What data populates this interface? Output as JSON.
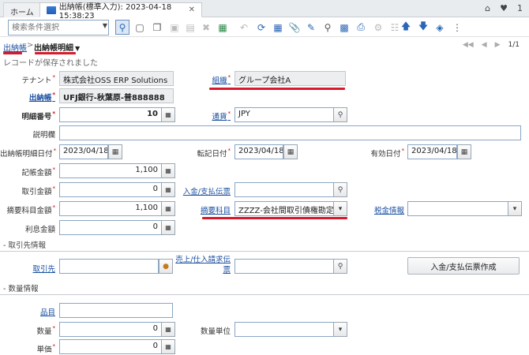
{
  "tabs": {
    "home": "ホーム",
    "active": "出納帳(標準入力): 2023-04-18 15:38:23",
    "close": "✕"
  },
  "topright": {
    "home": "⌂",
    "user": "♥",
    "count": "1"
  },
  "toolbar": {
    "search_placeholder": "検索条件選択"
  },
  "breadcrumb": {
    "parent": "出納帳",
    "sep": ">",
    "current": "出納帳明細"
  },
  "pager": {
    "text": "1/1"
  },
  "status": "レコードが保存されました",
  "form": {
    "tenant": {
      "label": "テナント",
      "value": "株式会社OSS ERP Solutions"
    },
    "org": {
      "label": "組織",
      "value": "グループ会社A"
    },
    "cashbook": {
      "label": "出納帳",
      "value": "UFJ銀行-秋葉原-普888888"
    },
    "line_no": {
      "label": "明細番号",
      "value": "10"
    },
    "currency": {
      "label": "通貨",
      "value": "JPY"
    },
    "description": {
      "label": "説明欄",
      "value": ""
    },
    "line_date": {
      "label": "出納帳明細日付",
      "value": "2023/04/18"
    },
    "posting_date": {
      "label": "転記日付",
      "value": "2023/04/18"
    },
    "valid_date": {
      "label": "有効日付",
      "value": "2023/04/18"
    },
    "stmt_amount": {
      "label": "記帳金額",
      "value": "1,100"
    },
    "trx_amount": {
      "label": "取引金額",
      "value": "0"
    },
    "payment": {
      "label": "入金/支払伝票",
      "value": ""
    },
    "charge_amount": {
      "label": "摘要科目金額",
      "value": "1,100"
    },
    "charge": {
      "label": "摘要科目",
      "value": "ZZZZ-会社間取引債権勘定"
    },
    "tax": {
      "label": "税金情報",
      "value": ""
    },
    "interest": {
      "label": "利息金額",
      "value": "0"
    }
  },
  "partner_section": {
    "title": "- 取引先情報",
    "bpartner": {
      "label": "取引先",
      "value": ""
    },
    "invoice": {
      "label": "売上/仕入請求伝票",
      "value": ""
    },
    "create_payment_button": "入金/支払伝票作成"
  },
  "qty_section": {
    "title": "- 数量情報",
    "product": {
      "label": "品目",
      "value": ""
    },
    "qty": {
      "label": "数量",
      "value": "0"
    },
    "uom": {
      "label": "数量単位",
      "value": ""
    },
    "price": {
      "label": "単価",
      "value": "0"
    }
  },
  "colors": {
    "accent": "#1a4fa0",
    "highlight": "#d8192b"
  }
}
